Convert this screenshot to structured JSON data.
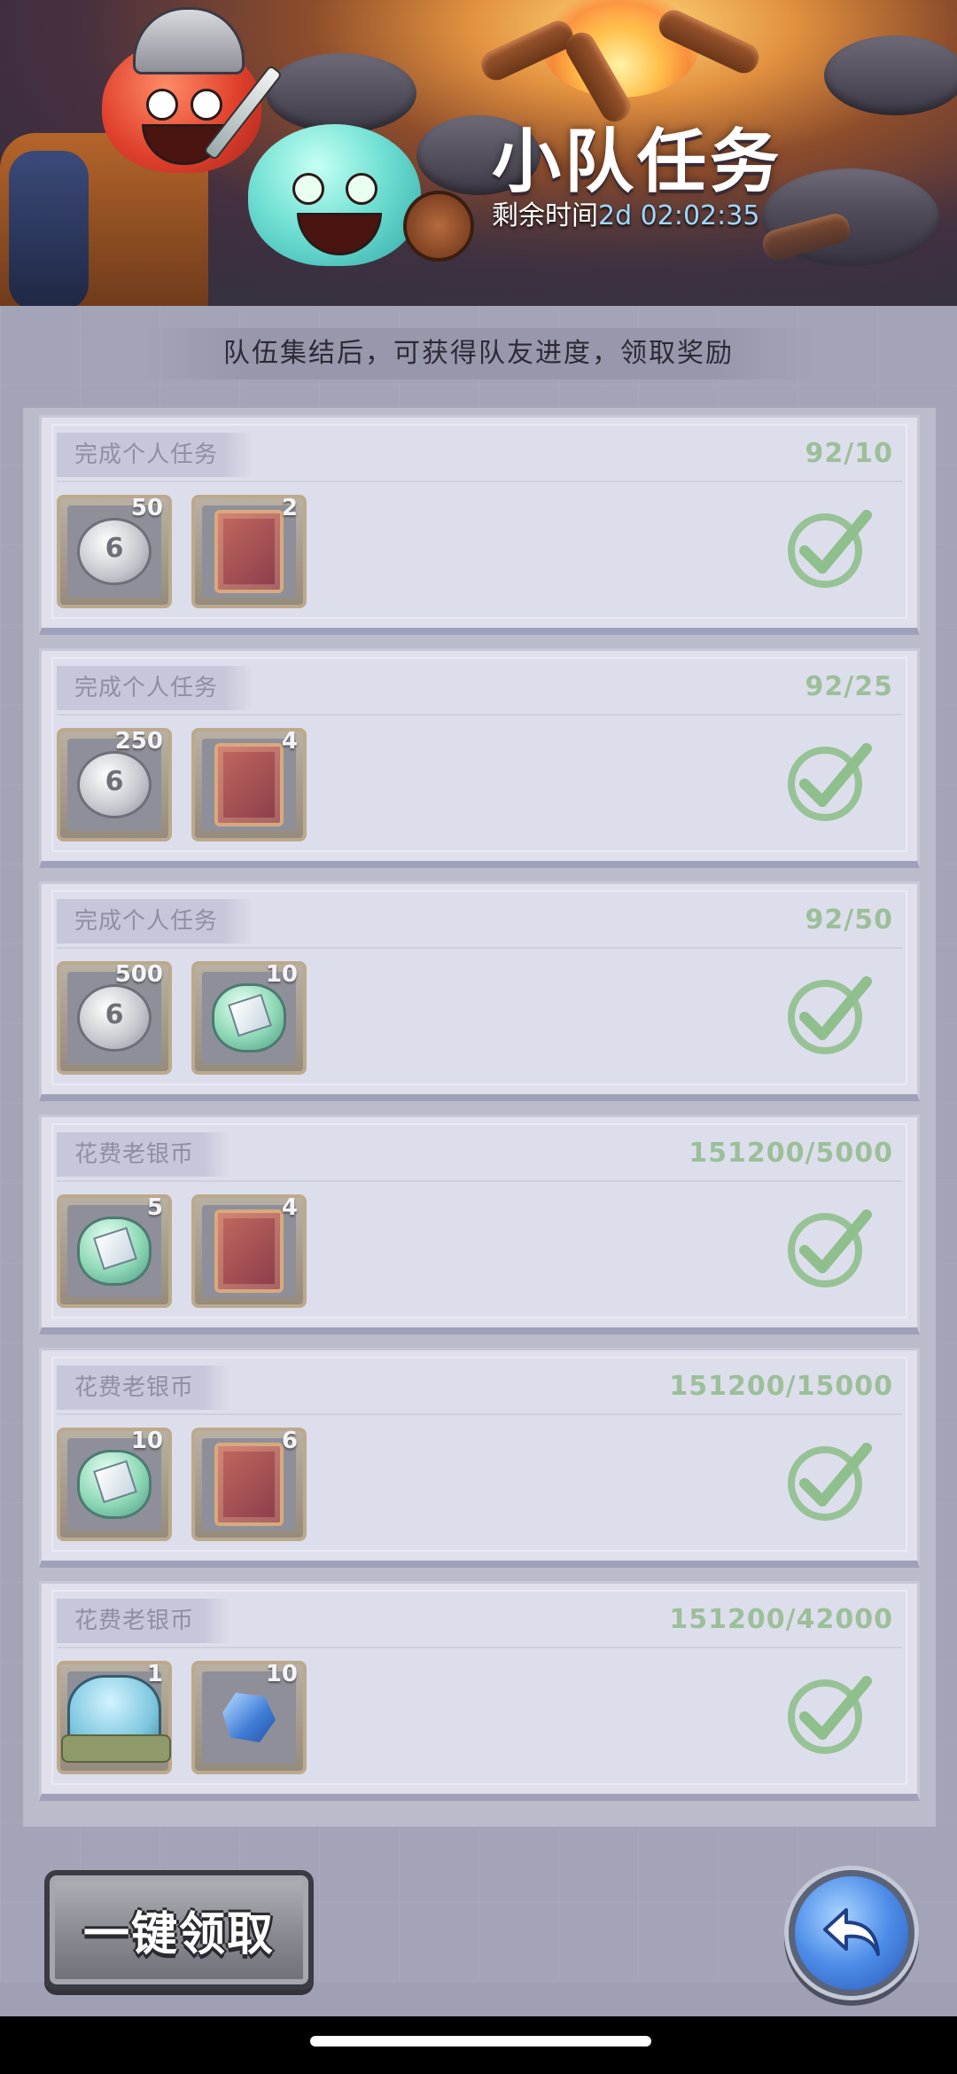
{
  "header": {
    "title": "小队任务",
    "timer_label": "剩余时间",
    "timer_value": "2d 02:02:35"
  },
  "hint": "队伍集结后，可获得队友进度，领取奖励",
  "tasks": [
    {
      "title": "完成个人任务",
      "progress": "92/10",
      "completed": true,
      "rewards": [
        {
          "icon": "silver-coin-icon",
          "qty": "50"
        },
        {
          "icon": "card-pack-icon",
          "qty": "2"
        }
      ]
    },
    {
      "title": "完成个人任务",
      "progress": "92/25",
      "completed": true,
      "rewards": [
        {
          "icon": "silver-coin-icon",
          "qty": "250"
        },
        {
          "icon": "card-pack-icon",
          "qty": "4"
        }
      ]
    },
    {
      "title": "完成个人任务",
      "progress": "92/50",
      "completed": true,
      "rewards": [
        {
          "icon": "silver-coin-icon",
          "qty": "500"
        },
        {
          "icon": "green-gem-icon",
          "qty": "10"
        }
      ]
    },
    {
      "title": "花费老银币",
      "progress": "151200/5000",
      "completed": true,
      "rewards": [
        {
          "icon": "green-gem-icon",
          "qty": "5"
        },
        {
          "icon": "card-pack-icon",
          "qty": "4"
        }
      ]
    },
    {
      "title": "花费老银币",
      "progress": "151200/15000",
      "completed": true,
      "rewards": [
        {
          "icon": "green-gem-icon",
          "qty": "10"
        },
        {
          "icon": "card-pack-icon",
          "qty": "6"
        }
      ]
    },
    {
      "title": "花费老银币",
      "progress": "151200/42000",
      "completed": true,
      "rewards": [
        {
          "icon": "pet-chest-icon",
          "qty": "1"
        },
        {
          "icon": "blue-crystal-icon",
          "qty": "10"
        }
      ]
    }
  ],
  "footer": {
    "claim_all_label": "一键领取",
    "back_icon": "back-arrow-icon"
  },
  "colors": {
    "progress_text": "#9cbf9a",
    "check_mark": "#8fbf8c",
    "timer_value": "#9ed8ff"
  }
}
